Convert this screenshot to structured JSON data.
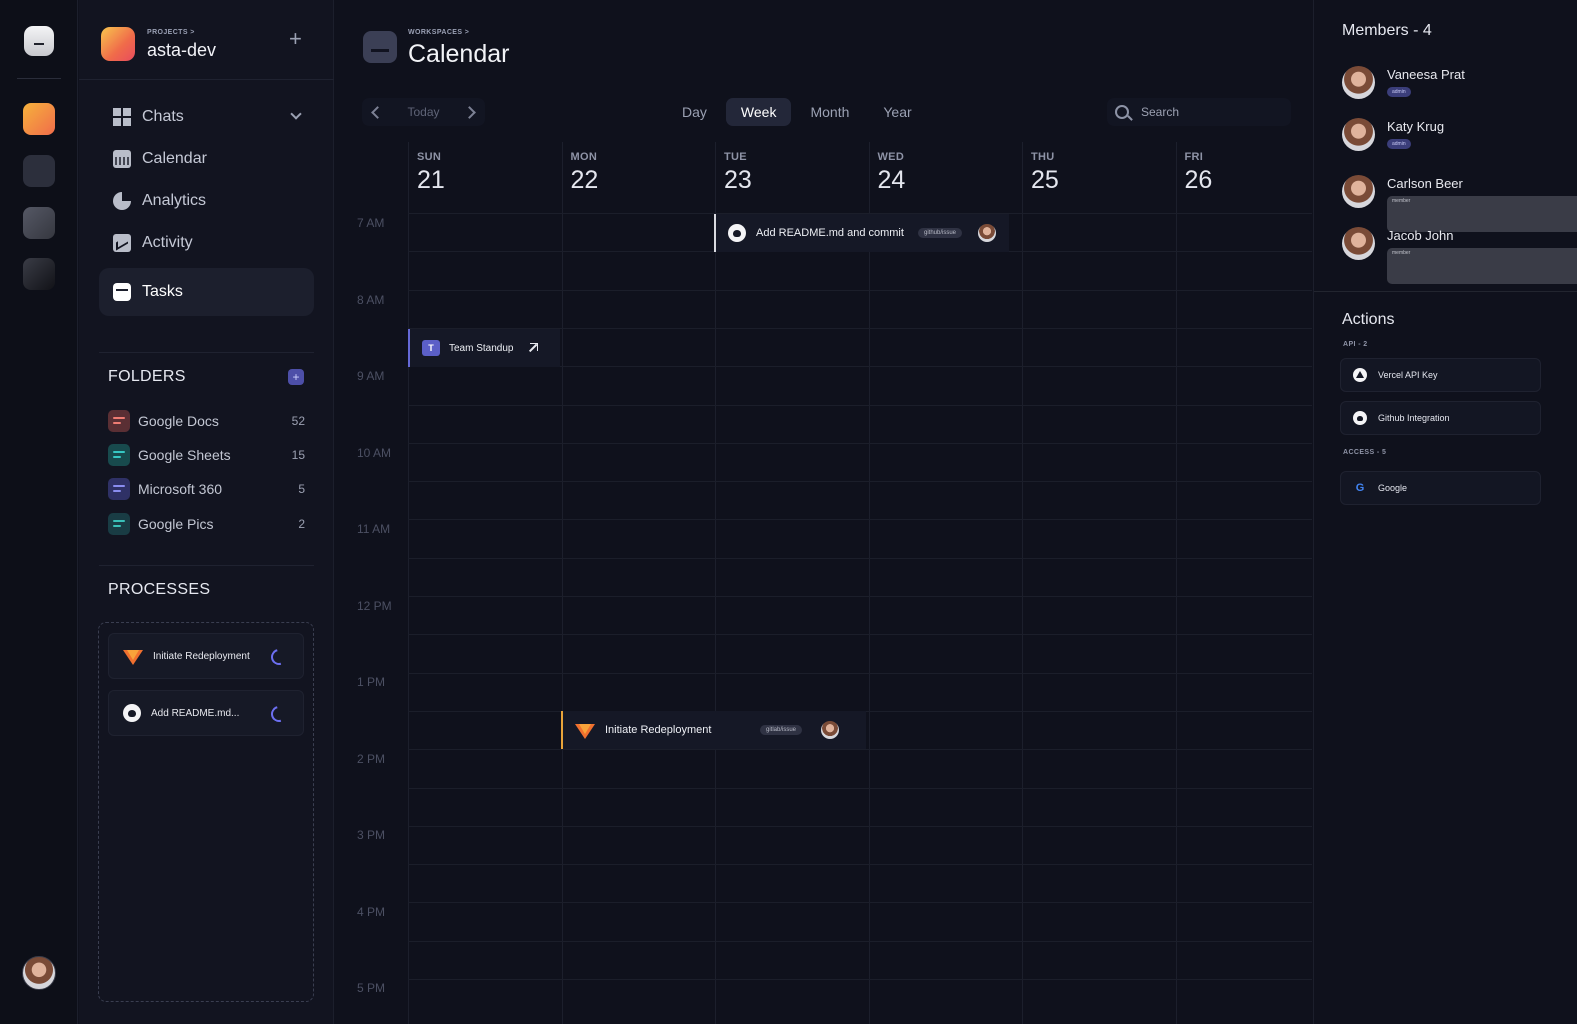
{
  "sidebar": {
    "project_kicker": "PROJECTS >",
    "project_name": "asta-dev",
    "add_label": "+",
    "nav": [
      {
        "label": "Chats",
        "icon": "chats-grid-icon"
      },
      {
        "label": "Calendar",
        "icon": "calendar-icon"
      },
      {
        "label": "Analytics",
        "icon": "analytics-pie-icon"
      },
      {
        "label": "Activity",
        "icon": "activity-chart-icon"
      },
      {
        "label": "Tasks",
        "icon": "tasks-icon",
        "active": true
      }
    ],
    "folders_title": "FOLDERS",
    "folders": [
      {
        "name": "Google Docs",
        "count": "52",
        "color": "#ef7c73"
      },
      {
        "name": "Google Sheets",
        "count": "15",
        "color": "#36c7c3"
      },
      {
        "name": "Microsoft 360",
        "count": "5",
        "color": "#8a8df0"
      },
      {
        "name": "Google Pics",
        "count": "2",
        "color": "#3ac0b8"
      }
    ],
    "processes_title": "PROCESSES",
    "processes": [
      {
        "label": "Initiate Redeployment",
        "icon": "gitlab-icon"
      },
      {
        "label": "Add README.md...",
        "icon": "github-icon"
      }
    ]
  },
  "main": {
    "kicker": "WORKSPACES >",
    "title": "Calendar",
    "today_label": "Today",
    "views": [
      {
        "label": "Day"
      },
      {
        "label": "Week",
        "active": true
      },
      {
        "label": "Month"
      },
      {
        "label": "Year"
      }
    ],
    "search_placeholder": "Search",
    "days": [
      {
        "dow": "SUN",
        "num": "21"
      },
      {
        "dow": "MON",
        "num": "22"
      },
      {
        "dow": "TUE",
        "num": "23"
      },
      {
        "dow": "WED",
        "num": "24"
      },
      {
        "dow": "THU",
        "num": "25"
      },
      {
        "dow": "FRI",
        "num": "26"
      }
    ],
    "times": [
      "7 AM",
      "8 AM",
      "9 AM",
      "10 AM",
      "11 AM",
      "12 PM",
      "1 PM",
      "2 PM",
      "3 PM",
      "4 PM",
      "5 PM"
    ],
    "events": {
      "readme": {
        "title": "Add README.md and commit",
        "badge": "github/issue"
      },
      "standup": {
        "title": "Team Standup"
      },
      "redeploy": {
        "title": "Initiate Redeployment",
        "badge": "gitlab/issue"
      }
    }
  },
  "right": {
    "members_title": "Members - 4",
    "members": [
      {
        "name": "Vaneesa Prat",
        "role": "admin"
      },
      {
        "name": "Katy Krug",
        "role": "admin"
      },
      {
        "name": "Carlson Beer",
        "role": "member"
      },
      {
        "name": "Jacob John",
        "role": "member"
      }
    ],
    "actions_title": "Actions",
    "api_kicker": "API - 2",
    "api": [
      {
        "label": "Vercel API Key",
        "icon": "vercel-icon"
      },
      {
        "label": "Github Integration",
        "icon": "github-icon"
      }
    ],
    "access_kicker": "ACCESS - 5",
    "access": [
      {
        "label": "Google",
        "icon": "google-icon"
      }
    ]
  },
  "colors": {
    "background": "#0f111c",
    "accent": "#6569d6",
    "gitlab": "#f0702f",
    "folder_add": "#4d4fa8"
  }
}
